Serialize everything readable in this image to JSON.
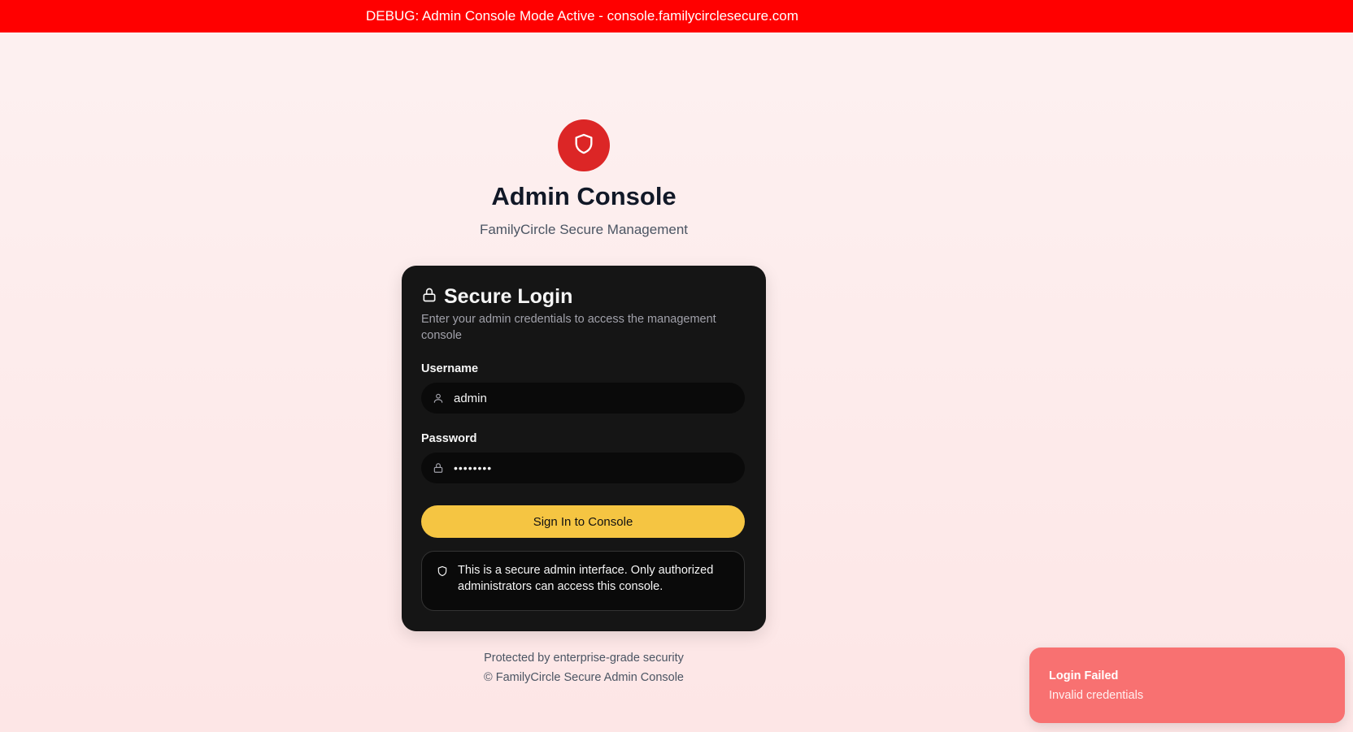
{
  "debug_bar": {
    "text": "DEBUG: Admin Console Mode Active - console.familycirclesecure.com"
  },
  "header": {
    "logo_icon": "shield-icon",
    "title": "Admin Console",
    "subtitle": "FamilyCircle Secure Management"
  },
  "login_card": {
    "title_icon": "lock-icon",
    "title": "Secure Login",
    "description": "Enter your admin credentials to access the management console",
    "username": {
      "label": "Username",
      "icon": "user-icon",
      "value": "admin"
    },
    "password": {
      "label": "Password",
      "icon": "lock-icon",
      "value": "••••••••"
    },
    "signin_label": "Sign In to Console",
    "notice": {
      "icon": "shield-icon",
      "text": "This is a secure admin interface. Only authorized administrators can access this console."
    }
  },
  "footer": {
    "line1": "Protected by enterprise-grade security",
    "line2": "© FamilyCircle Secure Admin Console"
  },
  "toast": {
    "title": "Login Failed",
    "message": "Invalid credentials"
  },
  "colors": {
    "debug_bar": "#ff0000",
    "accent_red": "#dc2626",
    "card_bg": "#151515",
    "button_yellow": "#f5c542",
    "toast_bg": "#f87171"
  }
}
